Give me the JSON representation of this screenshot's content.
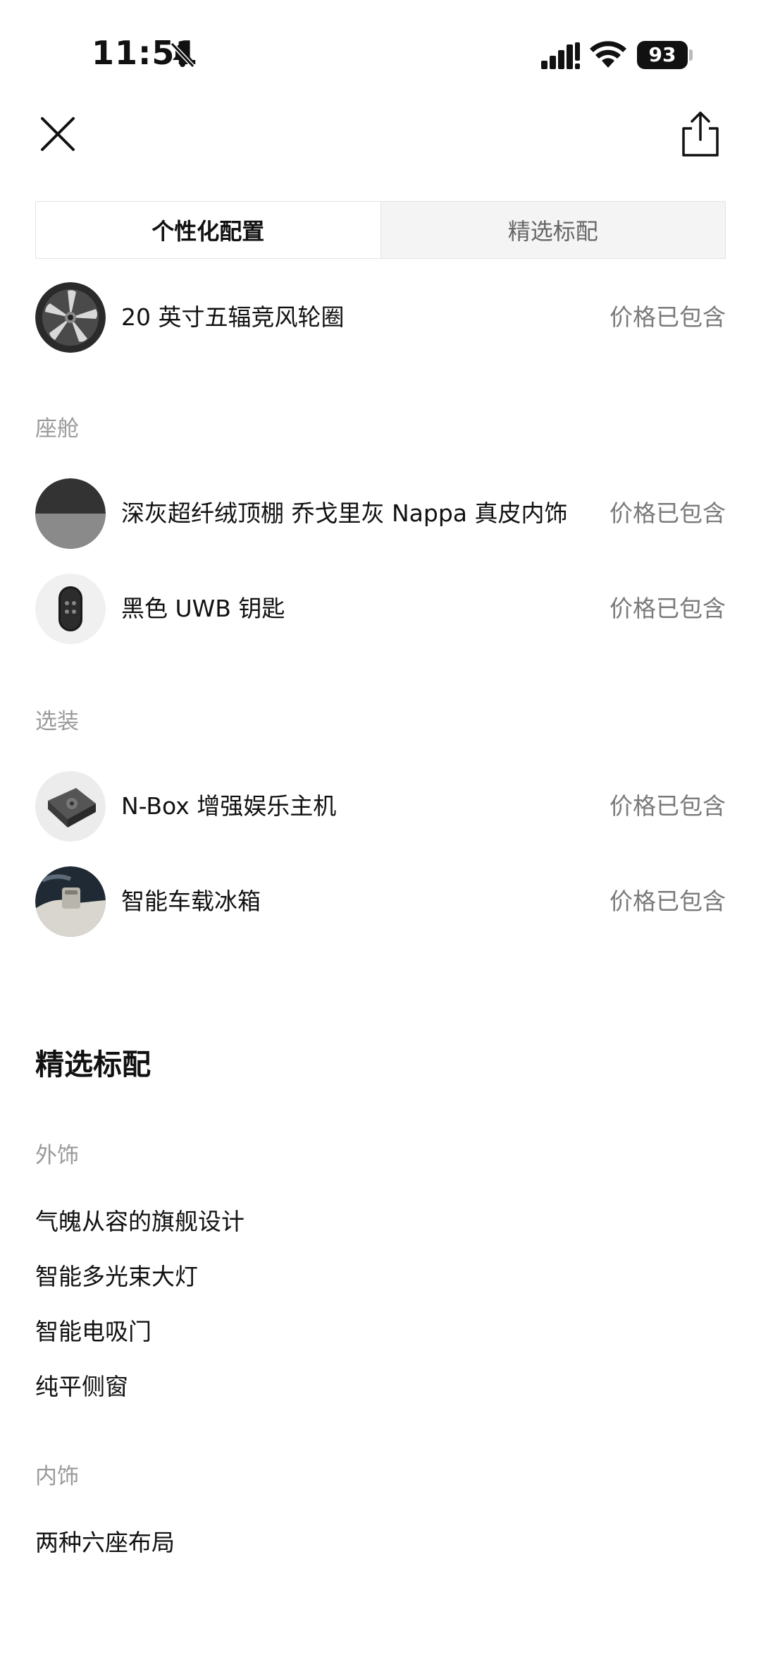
{
  "status_bar": {
    "time": "11:51",
    "battery": "93"
  },
  "tabs": {
    "personalized": "个性化配置",
    "standard": "精选标配"
  },
  "personalized": {
    "wheel": {
      "name": "20 英寸五辐竞风轮圈",
      "price": "价格已包含"
    },
    "cabin_label": "座舱",
    "cabin": [
      {
        "name": "深灰超纤绒顶棚 乔戈里灰 Nappa 真皮内饰",
        "price": "价格已包含"
      },
      {
        "name": "黑色 UWB 钥匙",
        "price": "价格已包含"
      }
    ],
    "options_label": "选装",
    "options": [
      {
        "name": "N-Box 增强娱乐主机",
        "price": "价格已包含"
      },
      {
        "name": "智能车载冰箱",
        "price": "价格已包含"
      }
    ]
  },
  "standard": {
    "title": "精选标配",
    "exterior_label": "外饰",
    "exterior": [
      "气魄从容的旗舰设计",
      "智能多光束大灯",
      "智能电吸门",
      "纯平侧窗"
    ],
    "interior_label": "内饰",
    "interior": [
      "两种六座布局"
    ]
  },
  "icons": {
    "close": "close-icon",
    "share": "share-icon",
    "bell_muted": "bell-slash-icon",
    "signal": "cellular-signal-icon",
    "wifi": "wifi-icon",
    "battery": "battery-icon"
  }
}
